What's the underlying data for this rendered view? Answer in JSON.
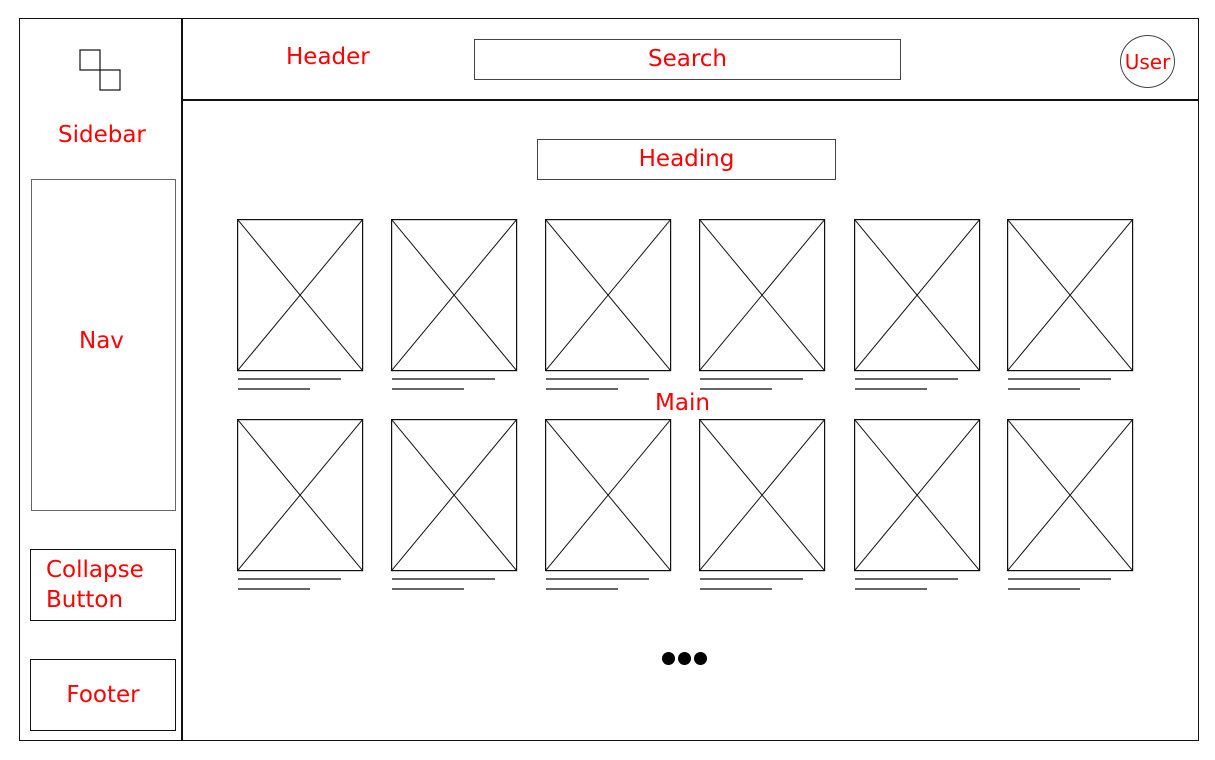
{
  "header": {
    "label": "Header",
    "search": "Search",
    "user": "User"
  },
  "sidebar": {
    "label": "Sidebar",
    "logo_icon": "overlapping-squares-icon",
    "nav": "Nav",
    "collapse_button": "Collapse\nButton",
    "footer": "Footer"
  },
  "main": {
    "label": "Main",
    "heading": "Heading",
    "rows": 2,
    "columns": 6,
    "image_placeholder_icon": "image-placeholder-icon",
    "more_icon": "ellipsis-icon"
  },
  "colors": {
    "annotation": "#ff0000",
    "wireframe": "#111111",
    "caption_line": "#666666"
  }
}
